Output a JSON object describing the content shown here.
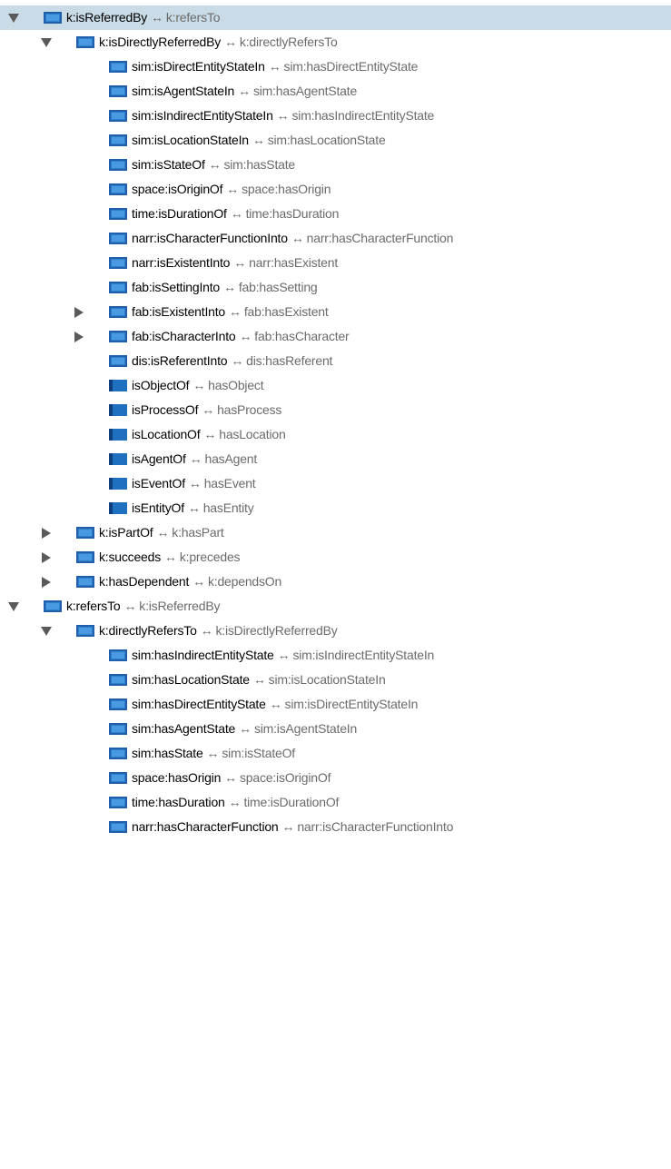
{
  "arrow_symbol": "↔",
  "colors": {
    "selection": "#c9dbe6",
    "name_text": "#000000",
    "inverse_text": "#6b6b6b",
    "object_icon": "#2f7fd0",
    "plain_icon": "#1f70be"
  },
  "tree": [
    {
      "depth": 0,
      "toggle": "expanded",
      "icon": "object-property-icon",
      "name": "k:isReferredBy",
      "inverse": "k:refersTo",
      "selected": true
    },
    {
      "depth": 1,
      "toggle": "expanded",
      "icon": "object-property-icon",
      "name": "k:isDirectlyReferredBy",
      "inverse": "k:directlyRefersTo",
      "selected": false
    },
    {
      "depth": 2,
      "toggle": "none",
      "icon": "object-property-icon",
      "name": "sim:isDirectEntityStateIn",
      "inverse": "sim:hasDirectEntityState",
      "selected": false
    },
    {
      "depth": 2,
      "toggle": "none",
      "icon": "object-property-icon",
      "name": "sim:isAgentStateIn",
      "inverse": "sim:hasAgentState",
      "selected": false
    },
    {
      "depth": 2,
      "toggle": "none",
      "icon": "object-property-icon",
      "name": "sim:isIndirectEntityStateIn",
      "inverse": "sim:hasIndirectEntityState",
      "selected": false
    },
    {
      "depth": 2,
      "toggle": "none",
      "icon": "object-property-icon",
      "name": "sim:isLocationStateIn",
      "inverse": "sim:hasLocationState",
      "selected": false
    },
    {
      "depth": 2,
      "toggle": "none",
      "icon": "object-property-icon",
      "name": "sim:isStateOf",
      "inverse": "sim:hasState",
      "selected": false
    },
    {
      "depth": 2,
      "toggle": "none",
      "icon": "object-property-icon",
      "name": "space:isOriginOf",
      "inverse": "space:hasOrigin",
      "selected": false
    },
    {
      "depth": 2,
      "toggle": "none",
      "icon": "object-property-icon",
      "name": "time:isDurationOf",
      "inverse": "time:hasDuration",
      "selected": false
    },
    {
      "depth": 2,
      "toggle": "none",
      "icon": "object-property-icon",
      "name": "narr:isCharacterFunctionInto",
      "inverse": "narr:hasCharacterFunction",
      "selected": false
    },
    {
      "depth": 2,
      "toggle": "none",
      "icon": "object-property-icon",
      "name": "narr:isExistentInto",
      "inverse": "narr:hasExistent",
      "selected": false
    },
    {
      "depth": 2,
      "toggle": "none",
      "icon": "object-property-icon",
      "name": "fab:isSettingInto",
      "inverse": "fab:hasSetting",
      "selected": false
    },
    {
      "depth": 2,
      "toggle": "collapsed",
      "icon": "object-property-icon",
      "name": "fab:isExistentInto",
      "inverse": "fab:hasExistent",
      "selected": false
    },
    {
      "depth": 2,
      "toggle": "collapsed",
      "icon": "object-property-icon",
      "name": "fab:isCharacterInto",
      "inverse": "fab:hasCharacter",
      "selected": false
    },
    {
      "depth": 2,
      "toggle": "none",
      "icon": "object-property-icon",
      "name": "dis:isReferentInto",
      "inverse": "dis:hasReferent",
      "selected": false
    },
    {
      "depth": 2,
      "toggle": "none",
      "icon": "local-property-icon",
      "name": "isObjectOf",
      "inverse": "hasObject",
      "selected": false
    },
    {
      "depth": 2,
      "toggle": "none",
      "icon": "local-property-icon",
      "name": "isProcessOf",
      "inverse": "hasProcess",
      "selected": false
    },
    {
      "depth": 2,
      "toggle": "none",
      "icon": "local-property-icon",
      "name": "isLocationOf",
      "inverse": "hasLocation",
      "selected": false
    },
    {
      "depth": 2,
      "toggle": "none",
      "icon": "local-property-icon",
      "name": "isAgentOf",
      "inverse": "hasAgent",
      "selected": false
    },
    {
      "depth": 2,
      "toggle": "none",
      "icon": "local-property-icon",
      "name": "isEventOf",
      "inverse": "hasEvent",
      "selected": false
    },
    {
      "depth": 2,
      "toggle": "none",
      "icon": "local-property-icon",
      "name": "isEntityOf",
      "inverse": "hasEntity",
      "selected": false
    },
    {
      "depth": 1,
      "toggle": "collapsed",
      "icon": "object-property-icon",
      "name": "k:isPartOf",
      "inverse": "k:hasPart",
      "selected": false
    },
    {
      "depth": 1,
      "toggle": "collapsed",
      "icon": "object-property-icon",
      "name": "k:succeeds",
      "inverse": "k:precedes",
      "selected": false
    },
    {
      "depth": 1,
      "toggle": "collapsed",
      "icon": "object-property-icon",
      "name": "k:hasDependent",
      "inverse": "k:dependsOn",
      "selected": false
    },
    {
      "depth": 0,
      "toggle": "expanded",
      "icon": "object-property-icon",
      "name": "k:refersTo",
      "inverse": "k:isReferredBy",
      "selected": false
    },
    {
      "depth": 1,
      "toggle": "expanded",
      "icon": "object-property-icon",
      "name": "k:directlyRefersTo",
      "inverse": "k:isDirectlyReferredBy",
      "selected": false
    },
    {
      "depth": 2,
      "toggle": "none",
      "icon": "object-property-icon",
      "name": "sim:hasIndirectEntityState",
      "inverse": "sim:isIndirectEntityStateIn",
      "selected": false
    },
    {
      "depth": 2,
      "toggle": "none",
      "icon": "object-property-icon",
      "name": "sim:hasLocationState",
      "inverse": "sim:isLocationStateIn",
      "selected": false
    },
    {
      "depth": 2,
      "toggle": "none",
      "icon": "object-property-icon",
      "name": "sim:hasDirectEntityState",
      "inverse": "sim:isDirectEntityStateIn",
      "selected": false
    },
    {
      "depth": 2,
      "toggle": "none",
      "icon": "object-property-icon",
      "name": "sim:hasAgentState",
      "inverse": "sim:isAgentStateIn",
      "selected": false
    },
    {
      "depth": 2,
      "toggle": "none",
      "icon": "object-property-icon",
      "name": "sim:hasState",
      "inverse": "sim:isStateOf",
      "selected": false
    },
    {
      "depth": 2,
      "toggle": "none",
      "icon": "object-property-icon",
      "name": "space:hasOrigin",
      "inverse": "space:isOriginOf",
      "selected": false
    },
    {
      "depth": 2,
      "toggle": "none",
      "icon": "object-property-icon",
      "name": "time:hasDuration",
      "inverse": "time:isDurationOf",
      "selected": false
    },
    {
      "depth": 2,
      "toggle": "none",
      "icon": "object-property-icon",
      "name": "narr:hasCharacterFunction",
      "inverse": "narr:isCharacterFunctionInto",
      "selected": false
    }
  ]
}
